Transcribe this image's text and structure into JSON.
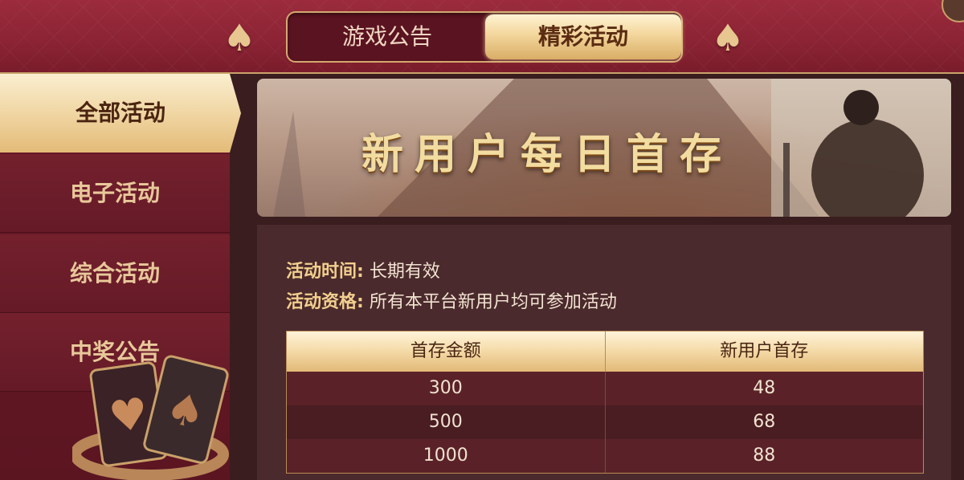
{
  "header": {
    "tabs": [
      {
        "label": "游戏公告",
        "active": false
      },
      {
        "label": "精彩活动",
        "active": true
      }
    ]
  },
  "sidebar": {
    "items": [
      {
        "label": "全部活动",
        "active": true
      },
      {
        "label": "电子活动",
        "active": false
      },
      {
        "label": "综合活动",
        "active": false
      },
      {
        "label": "中奖公告",
        "active": false
      }
    ]
  },
  "banner": {
    "title": "新用户每日首存"
  },
  "activity": {
    "time_label": "活动时间:",
    "time_value": "长期有效",
    "eligibility_label": "活动资格:",
    "eligibility_value": "所有本平台新用户均可参加活动"
  },
  "table": {
    "headers": [
      "首存金额",
      "新用户首存"
    ],
    "rows": [
      [
        "300",
        "48"
      ],
      [
        "500",
        "68"
      ],
      [
        "1000",
        "88"
      ]
    ]
  },
  "colors": {
    "header_red": "#8a2333",
    "gold": "#e3bb78",
    "panel": "#4a2a2c"
  }
}
